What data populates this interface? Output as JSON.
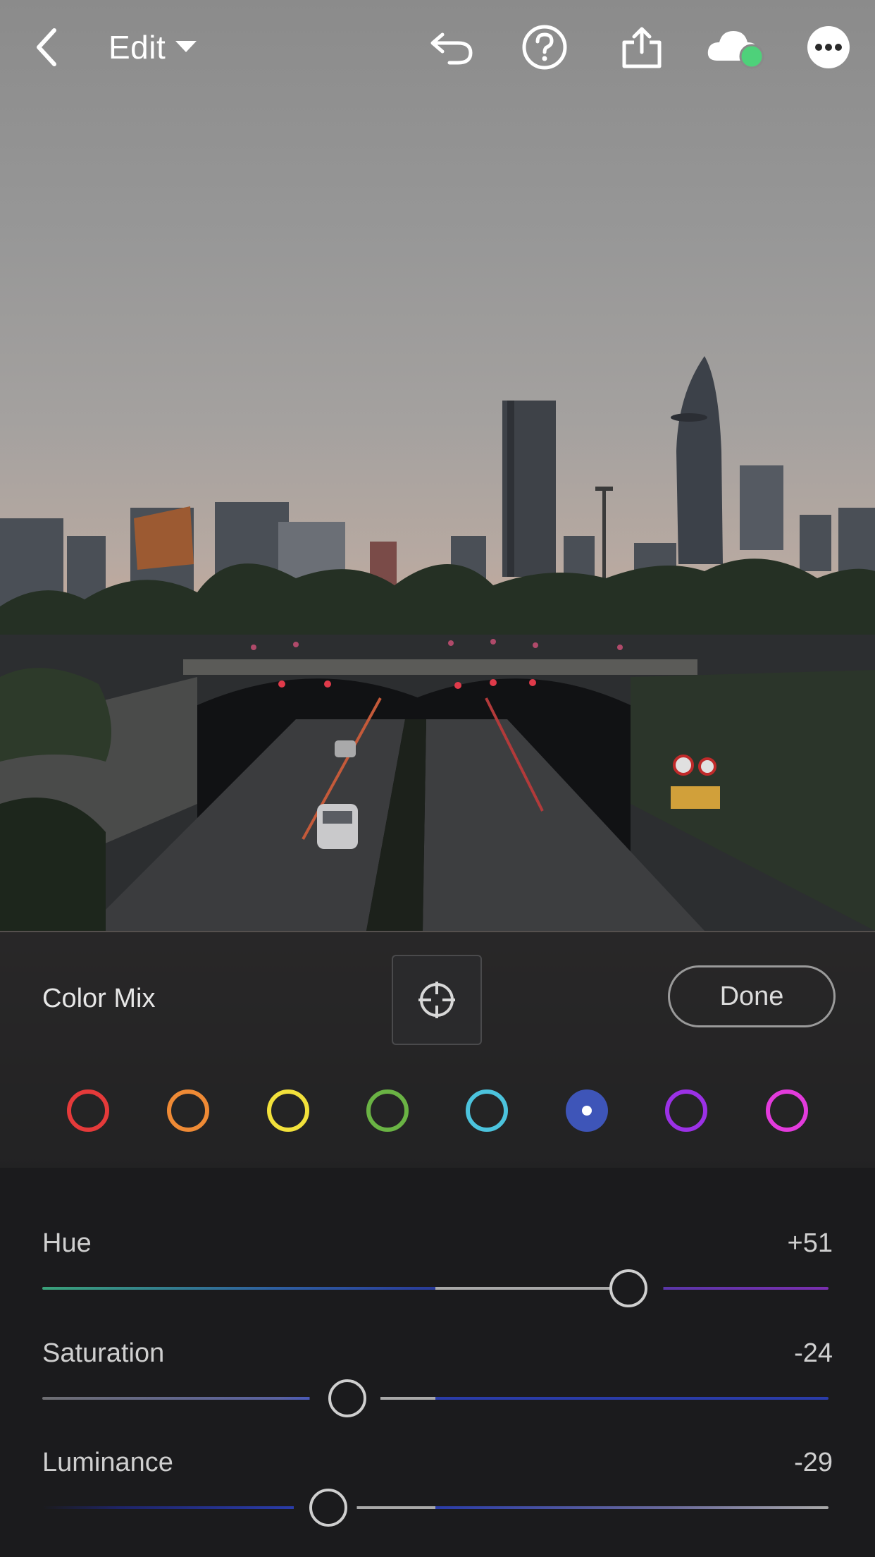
{
  "header": {
    "title": "Edit"
  },
  "panel": {
    "title": "Color Mix",
    "done_label": "Done"
  },
  "swatches": [
    {
      "color": "#e53a3a",
      "selected": false
    },
    {
      "color": "#ef8a35",
      "selected": false
    },
    {
      "color": "#f2e13b",
      "selected": false
    },
    {
      "color": "#6ab344",
      "selected": false
    },
    {
      "color": "#4cc3dd",
      "selected": false
    },
    {
      "color": "#3e55b8",
      "selected": true
    },
    {
      "color": "#9b31e6",
      "selected": false
    },
    {
      "color": "#e33bdc",
      "selected": false
    }
  ],
  "sliders": [
    {
      "name": "hue",
      "label": "Hue",
      "value": "+51",
      "numeric": 51
    },
    {
      "name": "saturation",
      "label": "Saturation",
      "value": "-24",
      "numeric": -24
    },
    {
      "name": "luminance",
      "label": "Luminance",
      "value": "-29",
      "numeric": -29
    }
  ],
  "colors": {
    "accent_green": "#4ed17a",
    "track_neutral": "#a8a8a8"
  }
}
